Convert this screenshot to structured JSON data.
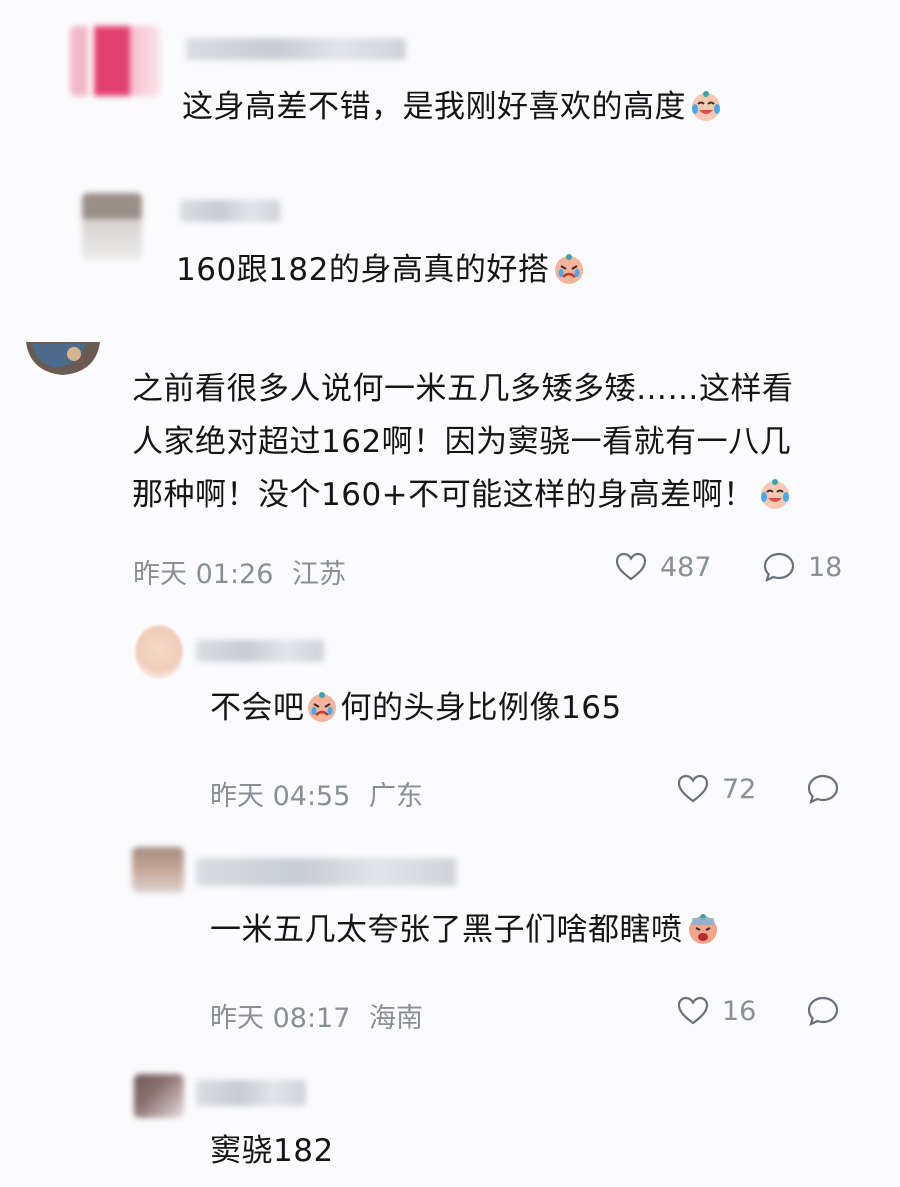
{
  "comments": [
    {
      "text": "这身高差不错，是我刚好喜欢的高度",
      "emoji": "crying-laughing-face"
    },
    {
      "text": "160跟182的身高真的好搭",
      "emoji": "crying-face"
    },
    {
      "lines": [
        "之前看很多人说何一米五几多矮多矮……这样看",
        "人家绝对超过162啊！因为窦骁一看就有一八几",
        "那种啊！没个160+不可能这样的身高差啊！"
      ],
      "emoji": "crying-laughing-face",
      "time": "昨天 01:26",
      "location": "江苏",
      "likes": "487",
      "replies": "18"
    },
    {
      "text_before": "不会吧",
      "text_after": "何的头身比例像165",
      "emoji": "crying-face",
      "time": "昨天 04:55",
      "location": "广东",
      "likes": "72"
    },
    {
      "text": "一米五几太夸张了黑子们啥都瞎喷",
      "emoji": "screaming-face",
      "time": "昨天 08:17",
      "location": "海南",
      "likes": "16"
    },
    {
      "text": "窦骁182"
    }
  ],
  "colors": {
    "text": "#151515",
    "meta": "#8a8f96"
  }
}
